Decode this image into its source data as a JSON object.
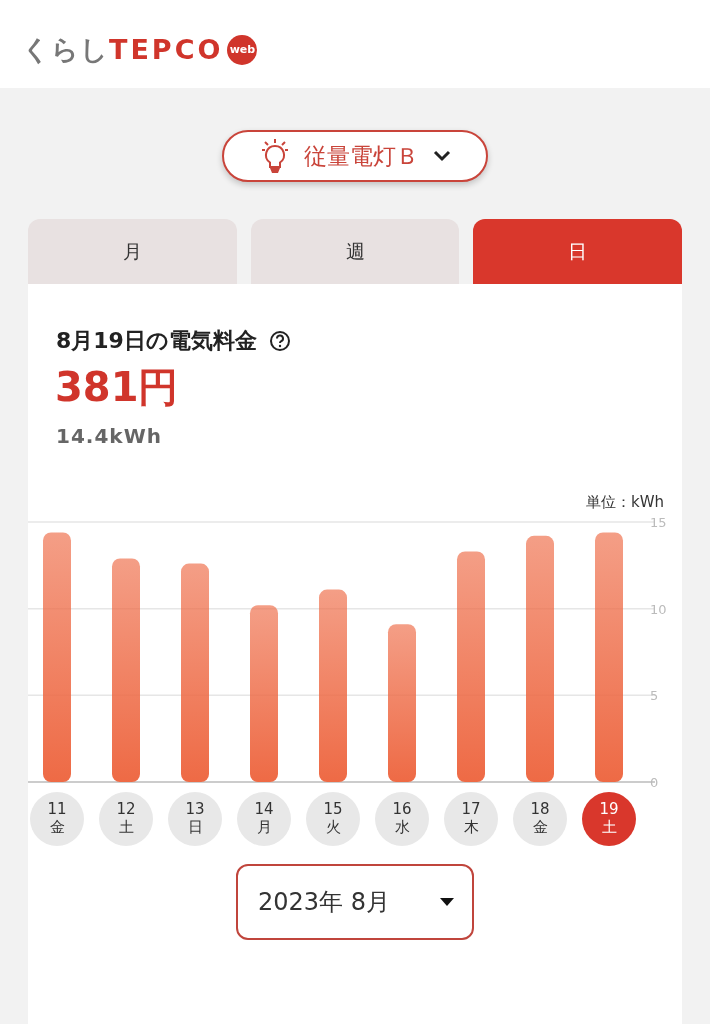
{
  "logo": {
    "kana": "くらし",
    "brand": "TEPCO",
    "badge": "web"
  },
  "plan_selector": {
    "label": "従量電灯Ｂ"
  },
  "tabs": [
    {
      "label": "月",
      "selected": false
    },
    {
      "label": "週",
      "selected": false
    },
    {
      "label": "日",
      "selected": true
    }
  ],
  "summary": {
    "title": "8月19日の電気料金",
    "price": "381円",
    "usage": "14.4kWh"
  },
  "unit_label": "単位：kWh",
  "chart_data": {
    "type": "bar",
    "ylim": [
      0,
      15
    ],
    "yticks": [
      0,
      5,
      10,
      15
    ],
    "series": [
      {
        "color": "#ee6a45",
        "values": [
          14.4,
          12.9,
          12.6,
          10.2,
          11.1,
          9.1,
          13.3,
          14.2,
          14.4
        ]
      }
    ]
  },
  "days": [
    {
      "date": "11",
      "weekday": "金",
      "selected": false
    },
    {
      "date": "12",
      "weekday": "土",
      "selected": false
    },
    {
      "date": "13",
      "weekday": "日",
      "selected": false
    },
    {
      "date": "14",
      "weekday": "月",
      "selected": false
    },
    {
      "date": "15",
      "weekday": "火",
      "selected": false
    },
    {
      "date": "16",
      "weekday": "水",
      "selected": false
    },
    {
      "date": "17",
      "weekday": "木",
      "selected": false
    },
    {
      "date": "18",
      "weekday": "金",
      "selected": false
    },
    {
      "date": "19",
      "weekday": "土",
      "selected": true
    }
  ],
  "month_select": {
    "value": "2023年 8月"
  }
}
